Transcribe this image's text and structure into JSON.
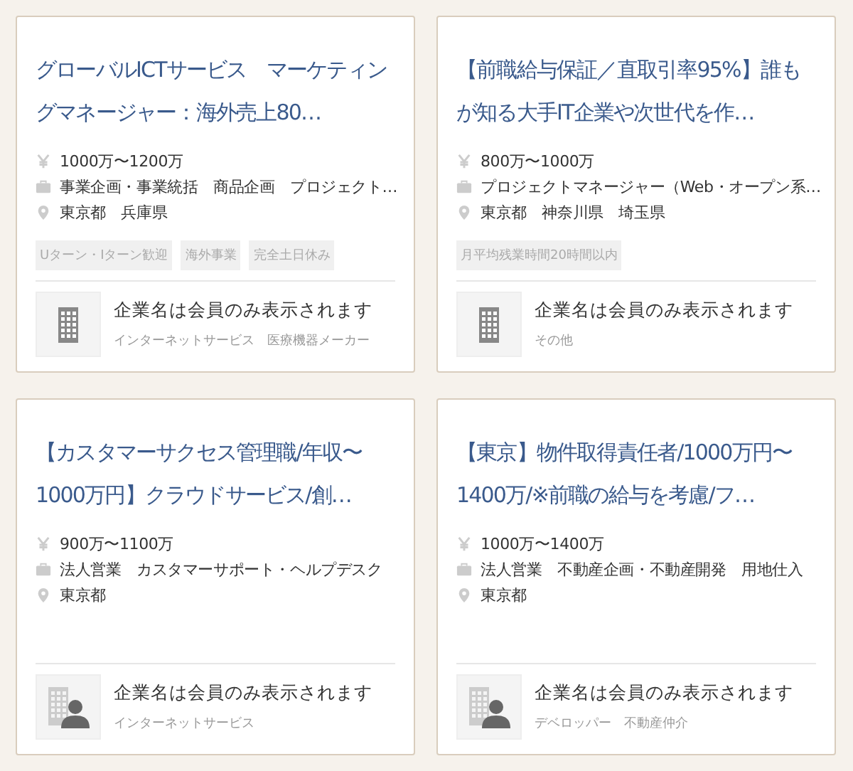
{
  "cards": [
    {
      "title": "グローバルICTサービス　マーケティングマネージャー：海外売上80…",
      "details": [
        {
          "kind": "salary",
          "text": "1000万〜1200万"
        },
        {
          "kind": "job",
          "text": "事業企画・事業統括　商品企画　プロジェクト…"
        },
        {
          "kind": "location",
          "text": "東京都　兵庫県"
        }
      ],
      "tags": [
        "Uターン・Iターン歓迎",
        "海外事業",
        "完全土日休み"
      ],
      "company": {
        "kind": "building",
        "name": "企業名は会員のみ表示されます",
        "industry": "インターネットサービス　医療機器メーカー"
      }
    },
    {
      "title": "【前職給与保証／直取引率95%】誰もが知る大手IT企業や次世代を作…",
      "details": [
        {
          "kind": "salary",
          "text": "800万〜1000万"
        },
        {
          "kind": "job",
          "text": "プロジェクトマネージャー（Web・オープン系…"
        },
        {
          "kind": "location",
          "text": "東京都　神奈川県　埼玉県"
        }
      ],
      "tags": [
        "月平均残業時間20時間以内"
      ],
      "company": {
        "kind": "building",
        "name": "企業名は会員のみ表示されます",
        "industry": "その他"
      }
    },
    {
      "title": "【カスタマーサクセス管理職/年収〜1000万円】クラウドサービス/創…",
      "details": [
        {
          "kind": "salary",
          "text": "900万〜1100万"
        },
        {
          "kind": "job",
          "text": "法人営業　カスタマーサポート・ヘルプデスク"
        },
        {
          "kind": "location",
          "text": "東京都"
        }
      ],
      "company": {
        "kind": "building-person",
        "name": "企業名は会員のみ表示されます",
        "industry": "インターネットサービス"
      }
    },
    {
      "title": "【東京】物件取得責任者/1000万円〜1400万/※前職の給与を考慮/フ…",
      "details": [
        {
          "kind": "salary",
          "text": "1000万〜1400万"
        },
        {
          "kind": "job",
          "text": "法人営業　不動産企画・不動産開発　用地仕入"
        },
        {
          "kind": "location",
          "text": "東京都"
        }
      ],
      "company": {
        "kind": "building-person",
        "name": "企業名は会員のみ表示されます",
        "industry": "デベロッパー　不動産仲介"
      }
    }
  ]
}
